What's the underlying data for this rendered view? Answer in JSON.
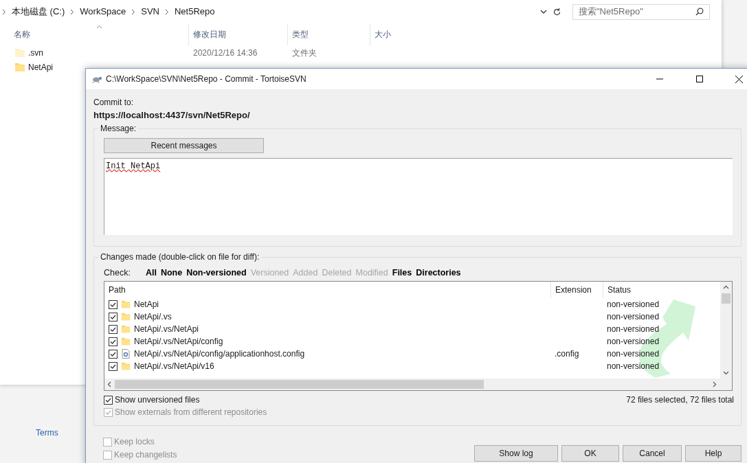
{
  "explorer": {
    "breadcrumb": [
      "本地磁盘 (C:)",
      "WorkSpace",
      "SVN",
      "Net5Repo"
    ],
    "search_placeholder": "搜索\"Net5Repo\"",
    "columns": [
      "名称",
      "修改日期",
      "类型",
      "大小"
    ],
    "rows": [
      {
        "name": ".svn",
        "date": "2020/12/16 14:36",
        "type": "文件夹",
        "hidden": true
      },
      {
        "name": "NetApi",
        "hidden": false
      }
    ]
  },
  "background_link": "Terms",
  "dialog": {
    "title": "C:\\WorkSpace\\SVN\\Net5Repo - Commit - TortoiseSVN",
    "commit_to_label": "Commit to:",
    "url": "https://localhost:4437/svn/Net5Repo/",
    "message_label": "Message:",
    "recent_button": "Recent messages",
    "message": "Init NetApi",
    "changes_label": "Changes made (double-click on file for diff):",
    "check_label": "Check:",
    "filters": [
      {
        "label": "All",
        "disabled": false
      },
      {
        "label": "None",
        "disabled": false
      },
      {
        "label": "Non-versioned",
        "disabled": false
      },
      {
        "label": "Versioned",
        "disabled": true
      },
      {
        "label": "Added",
        "disabled": true
      },
      {
        "label": "Deleted",
        "disabled": true
      },
      {
        "label": "Modified",
        "disabled": true
      },
      {
        "label": "Files",
        "disabled": false
      },
      {
        "label": "Directories",
        "disabled": false
      }
    ],
    "columns": [
      "Path",
      "Extension",
      "Status"
    ],
    "files": [
      {
        "kind": "folder",
        "path": "NetApi",
        "status": "non-versioned",
        "checked": true
      },
      {
        "kind": "folder",
        "path": "NetApi/.vs",
        "status": "non-versioned",
        "checked": true
      },
      {
        "kind": "folder",
        "path": "NetApi/.vs/NetApi",
        "status": "non-versioned",
        "checked": true
      },
      {
        "kind": "folder",
        "path": "NetApi/.vs/NetApi/config",
        "status": "non-versioned",
        "checked": true
      },
      {
        "kind": "config",
        "path": "NetApi/.vs/NetApi/config/applicationhost.config",
        "extension": ".config",
        "status": "non-versioned",
        "checked": true
      },
      {
        "kind": "folder",
        "path": "NetApi/.vs/NetApi/v16",
        "status": "non-versioned",
        "checked": true
      }
    ],
    "list_options": [
      {
        "label": "Show unversioned files",
        "checked": true,
        "disabled": false
      },
      {
        "label": "Show externals from different repositories",
        "checked": true,
        "disabled": true
      }
    ],
    "summary": "72 files selected, 72 files total",
    "bottom_options": [
      {
        "label": "Keep locks",
        "checked": false,
        "disabled": true
      },
      {
        "label": "Keep changelists",
        "checked": false,
        "disabled": true
      }
    ],
    "buttons": [
      "Show log",
      "OK",
      "Cancel",
      "Help"
    ]
  }
}
